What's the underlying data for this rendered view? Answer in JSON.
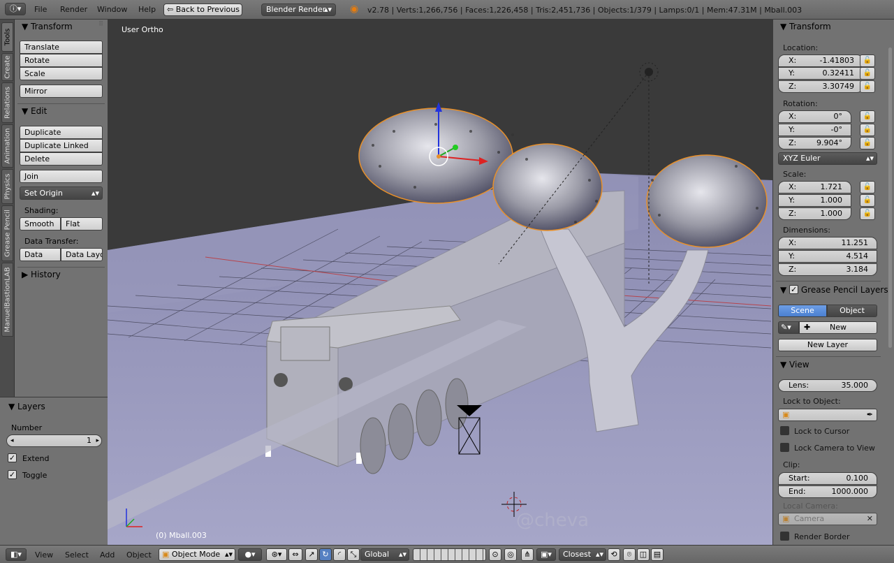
{
  "topbar": {
    "menu": [
      "File",
      "Render",
      "Window",
      "Help"
    ],
    "back_button": "Back to Previous",
    "render_engine": "Blender Render",
    "stats": "v2.78 | Verts:1,266,756 | Faces:1,226,458 | Tris:2,451,736 | Objects:1/379 | Lamps:0/1 | Mem:47.31M | Mball.003"
  },
  "sidetabs": [
    "Tools",
    "Create",
    "Relations",
    "Animation",
    "Physics",
    "Grease Pencil",
    "ManuelBastionLAB"
  ],
  "tools": {
    "transform_header": "Transform",
    "translate": "Translate",
    "rotate": "Rotate",
    "scale": "Scale",
    "mirror": "Mirror",
    "edit_header": "Edit",
    "duplicate": "Duplicate",
    "duplicate_linked": "Duplicate Linked",
    "delete": "Delete",
    "join": "Join",
    "set_origin": "Set Origin",
    "shading_label": "Shading:",
    "smooth": "Smooth",
    "flat": "Flat",
    "data_transfer_label": "Data Transfer:",
    "data": "Data",
    "data_layout": "Data Layo",
    "history_header": "History"
  },
  "layers": {
    "header": "Layers",
    "number_label": "Number",
    "number_value": "1",
    "extend": "Extend",
    "toggle": "Toggle"
  },
  "viewport": {
    "view_label": "User Ortho",
    "object_label": "(0) Mball.003",
    "watermark": "@cheva"
  },
  "properties": {
    "transform_header": "Transform",
    "location_label": "Location:",
    "location": [
      {
        "axis": "X:",
        "value": "-1.41803"
      },
      {
        "axis": "Y:",
        "value": "0.32411"
      },
      {
        "axis": "Z:",
        "value": "3.30749"
      }
    ],
    "rotation_label": "Rotation:",
    "rotation": [
      {
        "axis": "X:",
        "value": "0°"
      },
      {
        "axis": "Y:",
        "value": "-0°"
      },
      {
        "axis": "Z:",
        "value": "9.904°"
      }
    ],
    "rotation_mode": "XYZ Euler",
    "scale_label": "Scale:",
    "scale": [
      {
        "axis": "X:",
        "value": "1.721"
      },
      {
        "axis": "Y:",
        "value": "1.000"
      },
      {
        "axis": "Z:",
        "value": "1.000"
      }
    ],
    "dimensions_label": "Dimensions:",
    "dimensions": [
      {
        "axis": "X:",
        "value": "11.251"
      },
      {
        "axis": "Y:",
        "value": "4.514"
      },
      {
        "axis": "Z:",
        "value": "3.184"
      }
    ],
    "grease_header": "Grease Pencil Layers",
    "scene_tab": "Scene",
    "object_tab": "Object",
    "new_button": "New",
    "new_layer_button": "New Layer",
    "view_header": "View",
    "lens_label": "Lens:",
    "lens_value": "35.000",
    "lock_object_label": "Lock to Object:",
    "lock_cursor": "Lock to Cursor",
    "lock_camera": "Lock Camera to View",
    "clip_label": "Clip:",
    "clip_start_label": "Start:",
    "clip_start": "0.100",
    "clip_end_label": "End:",
    "clip_end": "1000.000",
    "local_camera_label": "Local Camera:",
    "camera_placeholder": "Camera",
    "render_border": "Render Border"
  },
  "bottombar": {
    "view": "View",
    "select": "Select",
    "add": "Add",
    "object": "Object",
    "mode": "Object Mode",
    "orientation": "Global",
    "snap": "Closest"
  },
  "colors": {
    "accent": "#5680c2",
    "panel": "#727272",
    "viewport_bg": "#3a3a3a"
  }
}
